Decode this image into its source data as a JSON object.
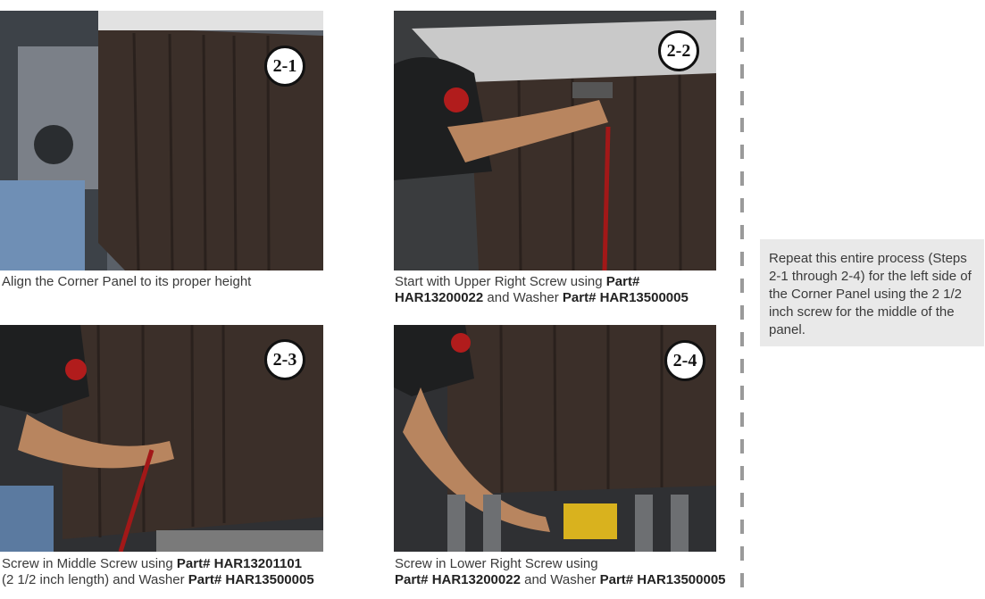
{
  "steps": [
    {
      "badge": "2-1",
      "caption_lines": [
        [
          {
            "t": "Align the Corner Panel to its proper height",
            "b": false
          }
        ]
      ]
    },
    {
      "badge": "2-2",
      "caption_lines": [
        [
          {
            "t": "Start with Upper Right Screw using ",
            "b": false
          },
          {
            "t": "Part#",
            "b": true
          }
        ],
        [
          {
            "t": "HAR13200022",
            "b": true
          },
          {
            "t": " and Washer ",
            "b": false
          },
          {
            "t": "Part# HAR13500005",
            "b": true
          }
        ]
      ]
    },
    {
      "badge": "2-3",
      "caption_lines": [
        [
          {
            "t": "Screw in Middle Screw using ",
            "b": false
          },
          {
            "t": "Part# HAR13201101",
            "b": true
          }
        ],
        [
          {
            "t": "(2 1/2 inch length) and Washer ",
            "b": false
          },
          {
            "t": "Part# HAR13500005",
            "b": true
          }
        ]
      ]
    },
    {
      "badge": "2-4",
      "caption_lines": [
        [
          {
            "t": "Screw in Lower Right Screw using",
            "b": false
          }
        ],
        [
          {
            "t": "Part# HAR13200022",
            "b": true
          },
          {
            "t": " and Washer ",
            "b": false
          },
          {
            "t": "Part# HAR13500005",
            "b": true
          }
        ]
      ]
    }
  ],
  "note": {
    "text": "Repeat this entire process (Steps 2-1 through 2-4) for the left side of the Corner Panel using the 2 1/2 inch screw for the middle of the panel."
  },
  "colors": {
    "panel": "#3b2f29",
    "note_bg": "#e9e9e9",
    "divider": "#9a9a9a"
  }
}
